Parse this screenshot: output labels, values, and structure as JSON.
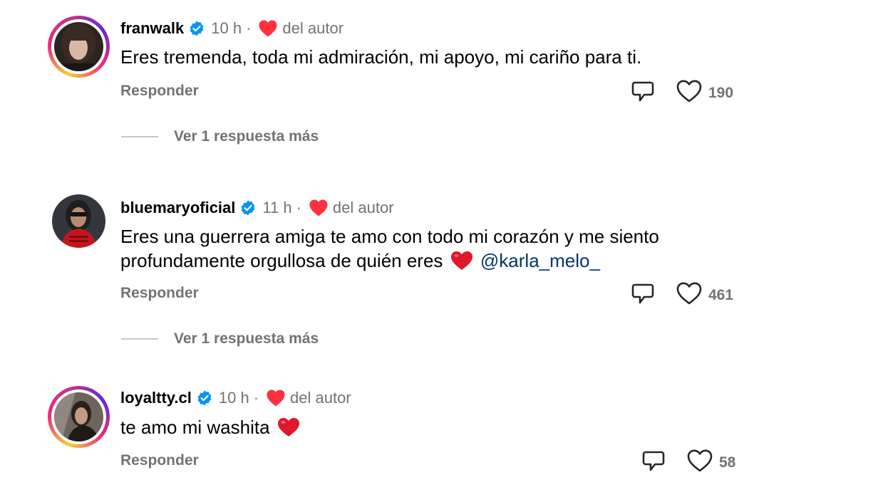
{
  "comments": [
    {
      "username": "franwalk",
      "verified": true,
      "time": "10 h",
      "separator": "·",
      "author_tag": "del autor",
      "text": "Eres tremenda, toda mi admiración, mi apoyo, mi cariño para ti.",
      "reply_label": "Responder",
      "likes": "190",
      "more_replies": "Ver 1 respuesta más",
      "story_ring": true
    },
    {
      "username": "bluemaryoficial",
      "verified": true,
      "time": "11 h",
      "separator": "·",
      "author_tag": "del autor",
      "text_line1": "Eres una guerrera amiga te amo con todo mi corazón y me siento",
      "text_line2": "profundamente orgullosa de quién eres",
      "mention": "@karla_melo_",
      "reply_label": "Responder",
      "likes": "461",
      "more_replies": "Ver 1 respuesta más",
      "story_ring": false
    },
    {
      "username": "loyaltty.cl",
      "verified": true,
      "time": "10 h",
      "separator": "·",
      "author_tag": "del autor",
      "text": "te amo mi washita",
      "reply_label": "Responder",
      "likes": "58",
      "story_ring": true
    }
  ],
  "colors": {
    "verified_badge": "#0095f6",
    "author_heart": "#ff3040",
    "secondary_text": "#737373",
    "mention": "#00376b"
  },
  "icons": [
    "verified-badge-icon",
    "heart-icon",
    "dislike-icon",
    "like-heart-outline-icon",
    "red-heart-emoji"
  ]
}
